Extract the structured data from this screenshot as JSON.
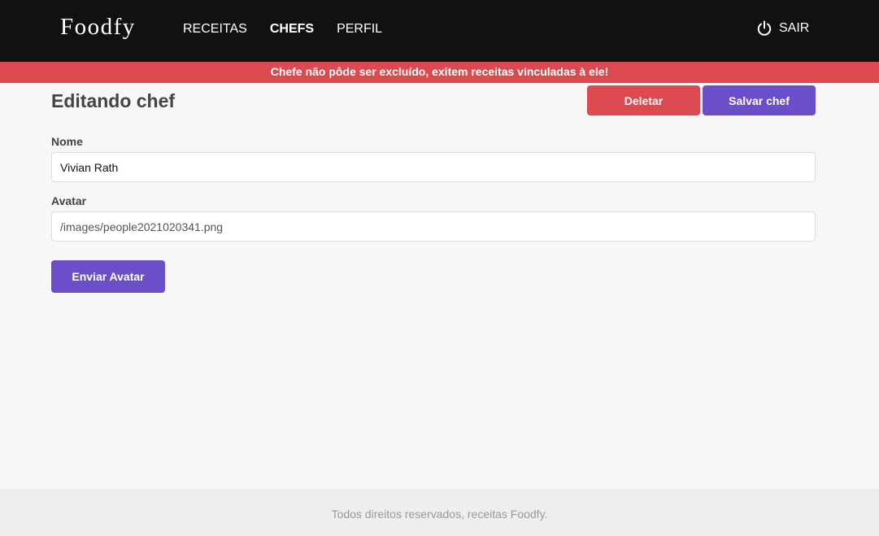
{
  "header": {
    "logo": "Foodfy",
    "nav": [
      {
        "label": "RECEITAS",
        "active": false
      },
      {
        "label": "CHEFS",
        "active": true
      },
      {
        "label": "PERFIL",
        "active": false
      }
    ],
    "logout_label": "SAIR",
    "logout_icon": "power-icon"
  },
  "alert": {
    "message": "Chefe não pôde ser excluído, exitem receitas vinculadas à ele!",
    "color": "#dc4a4f"
  },
  "main": {
    "title": "Editando chef",
    "delete_label": "Deletar",
    "save_label": "Salvar chef",
    "fields": {
      "name_label": "Nome",
      "name_value": "Vivian Rath",
      "avatar_label": "Avatar",
      "avatar_value": "/images/people2021020341.png"
    },
    "upload_label": "Enviar Avatar"
  },
  "footer": {
    "text": "Todos direitos reservados, receitas Foodfy."
  },
  "colors": {
    "header_bg": "#111111",
    "danger": "#dc4a4f",
    "primary": "#6a4fc8",
    "background": "#f7f7f7"
  }
}
